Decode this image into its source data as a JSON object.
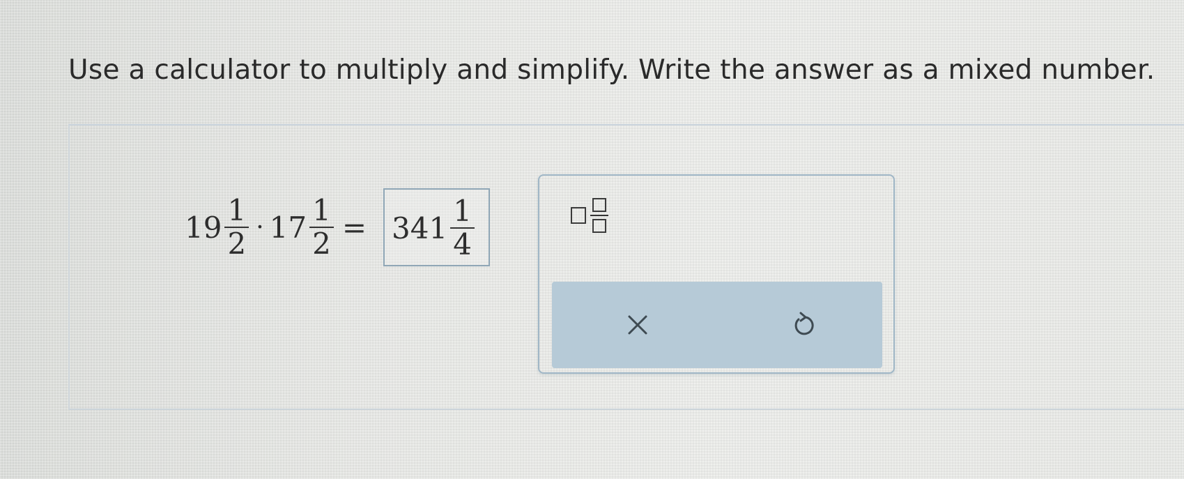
{
  "prompt": {
    "instruction": "Use a calculator to multiply and simplify. Write the answer as a mixed number."
  },
  "equation": {
    "factor1": {
      "whole": "19",
      "numerator": "1",
      "denominator": "2"
    },
    "operator": "·",
    "factor2": {
      "whole": "17",
      "numerator": "1",
      "denominator": "2"
    },
    "equals": "=",
    "answer": {
      "whole": "341",
      "numerator": "1",
      "denominator": "4"
    }
  },
  "tools": {
    "template": "mixed-fraction-icon",
    "actions": [
      {
        "name": "clear",
        "icon": "x-icon"
      },
      {
        "name": "reset",
        "icon": "undo-icon"
      }
    ]
  },
  "colors": {
    "panel_border": "#9fb6c6",
    "action_bar": "#b6cad7",
    "answer_border": "#8fa6b6"
  }
}
